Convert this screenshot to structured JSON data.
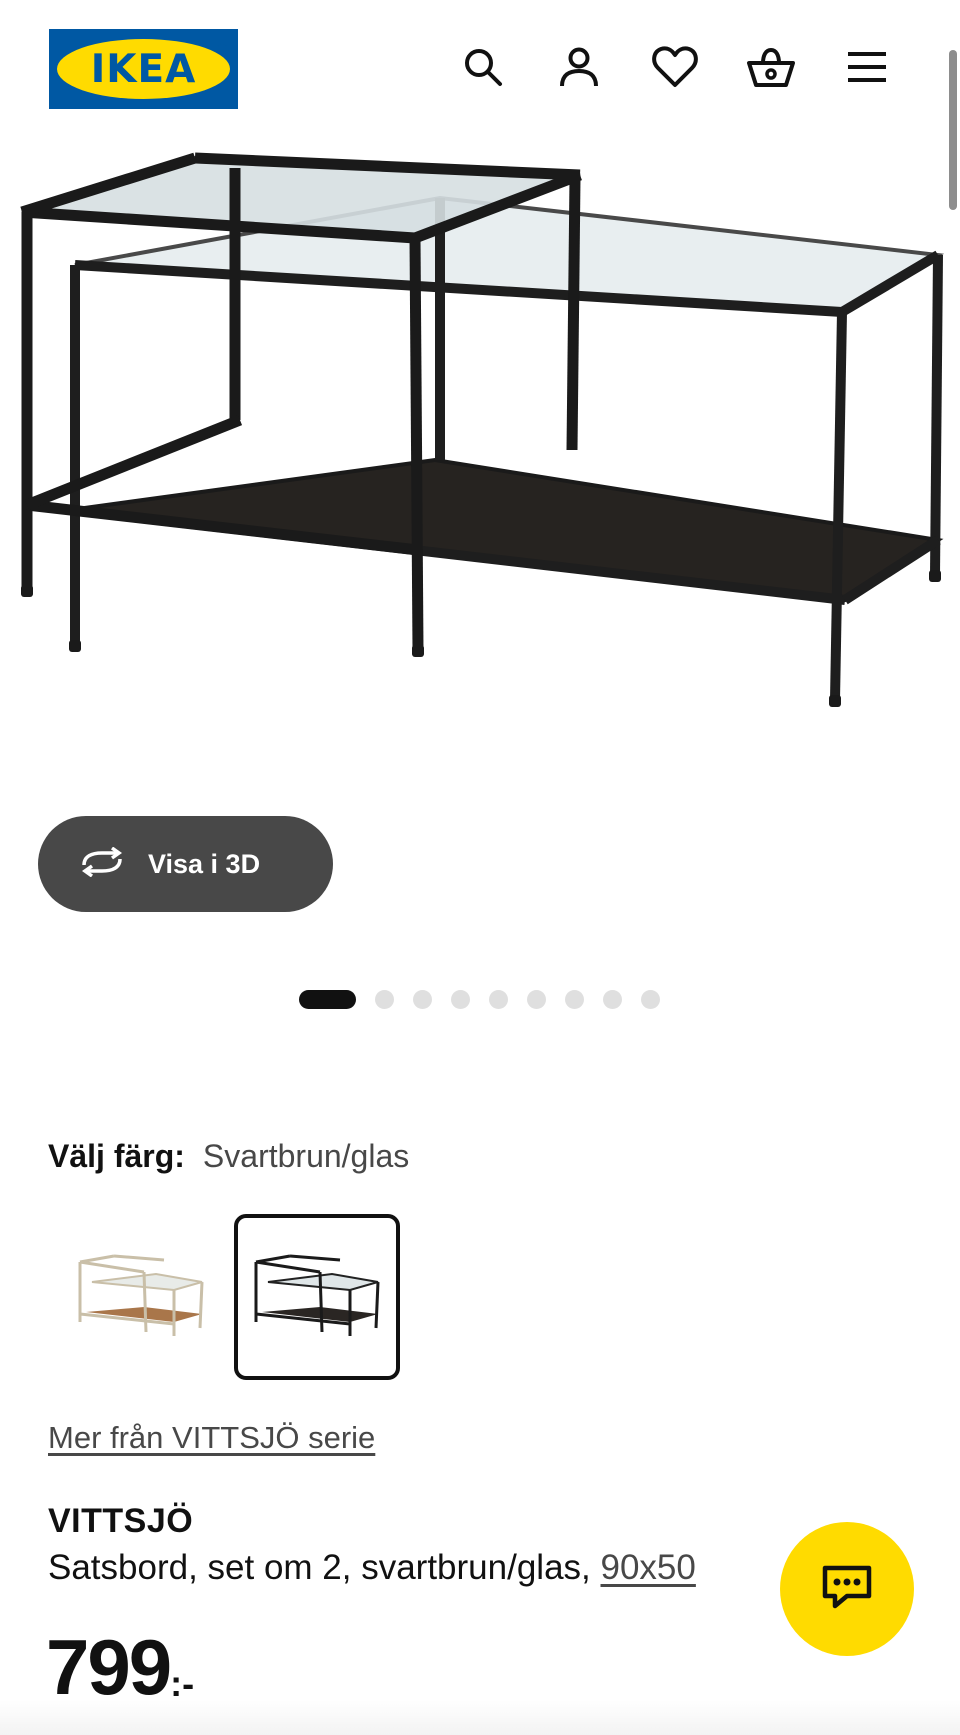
{
  "header": {
    "logo_text": "IKEA",
    "icons": [
      "search-icon",
      "user-icon",
      "heart-icon",
      "basket-icon",
      "menu-icon"
    ]
  },
  "gallery": {
    "view_3d_label": "Visa i 3D",
    "total_images": 9,
    "active_index": 0
  },
  "colour": {
    "label": "Välj färg:",
    "selected_value": "Svartbrun/glas",
    "options": [
      "white-stain-glass",
      "black-brown-glass"
    ],
    "selected_index": 1
  },
  "series_link": "Mer från VITTSJÖ serie",
  "product": {
    "name": "VITTSJÖ",
    "description": "Satsbord, set om 2, svartbrun/glas,",
    "size": "90x50",
    "price": "799",
    "price_suffix": ":-"
  },
  "colors": {
    "ikea_blue": "#0058a3",
    "ikea_yellow": "#ffdb00",
    "dark_button": "#484848"
  }
}
